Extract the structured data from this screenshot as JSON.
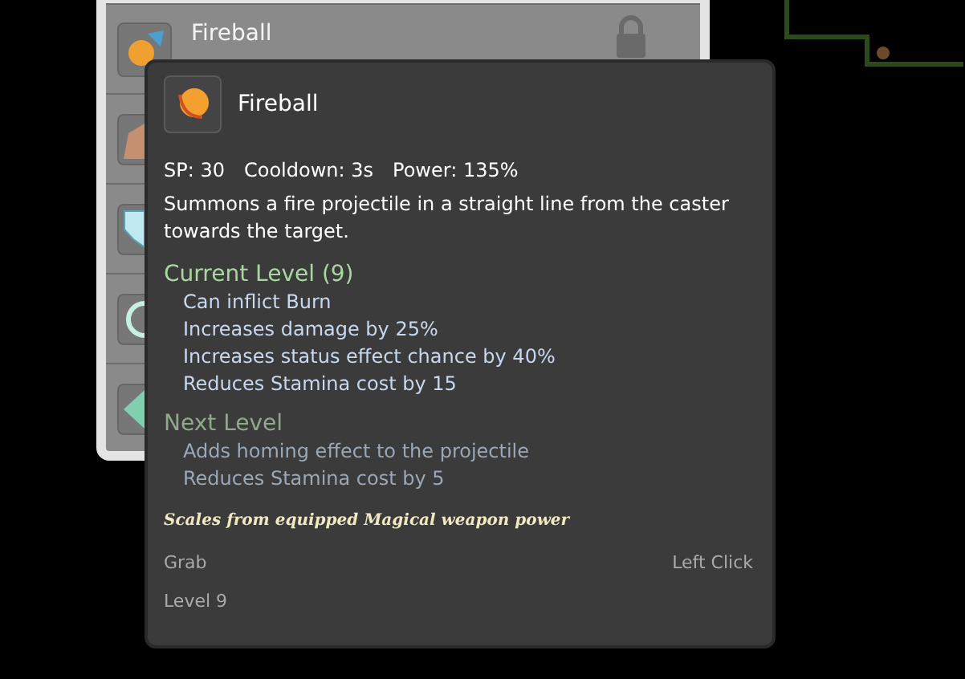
{
  "skill_list": {
    "top_row": {
      "name": "Fireball",
      "locked": true
    }
  },
  "tooltip": {
    "title": "Fireball",
    "stats": [
      "SP: 30",
      "Cooldown: 3s",
      "Power: 135%"
    ],
    "description": "Summons a fire projectile in a straight line from the caster towards the target.",
    "sections": [
      {
        "kind": "current",
        "heading": "Current Level (9)",
        "effects": [
          "Can inflict Burn",
          "Increases damage by 25%",
          "Increases status effect chance by 40%",
          "Reduces Stamina cost by 15"
        ]
      },
      {
        "kind": "next",
        "heading": "Next Level",
        "effects": [
          "Adds homing effect to the projectile",
          "Reduces Stamina cost by 5"
        ]
      }
    ],
    "note": "Scales from equipped Magical weapon power",
    "actions": [
      {
        "label": "Grab",
        "input": "Left Click"
      }
    ],
    "footer": "Level 9"
  }
}
